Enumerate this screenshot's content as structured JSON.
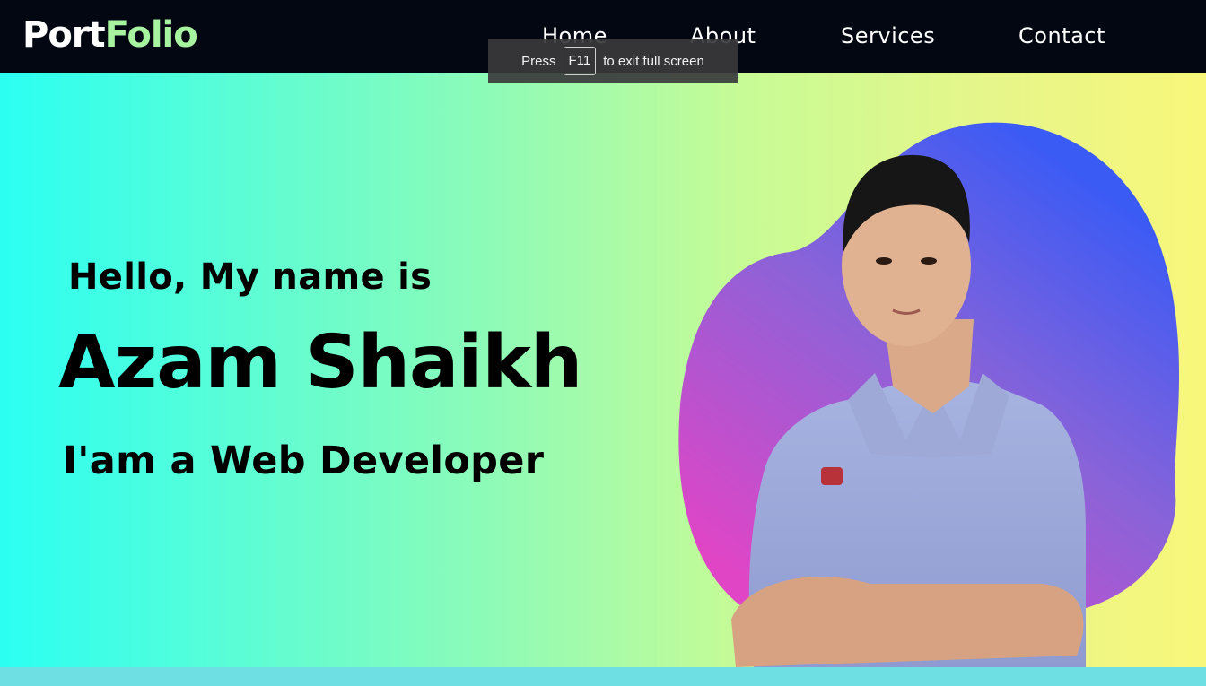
{
  "nav": {
    "logo_part1": "Port",
    "logo_part2": "Folio",
    "links": [
      "Home",
      "About",
      "Services",
      "Contact"
    ]
  },
  "fullscreen_toast": {
    "prefix": "Press",
    "key": "F11",
    "suffix": "to exit full screen"
  },
  "hero": {
    "greeting": "Hello, My name is",
    "name": "Azam Shaikh",
    "role": "I'am a Web Developer",
    "image": "profile-photo-with-gradient-blob"
  },
  "colors": {
    "nav_bg": "#030712",
    "logo_accent": "#a7f3a0",
    "gradient_left": "#2bfff2",
    "gradient_right": "#f8f77a",
    "blob_top": "#3b5bf5",
    "blob_bottom": "#e045c6"
  }
}
